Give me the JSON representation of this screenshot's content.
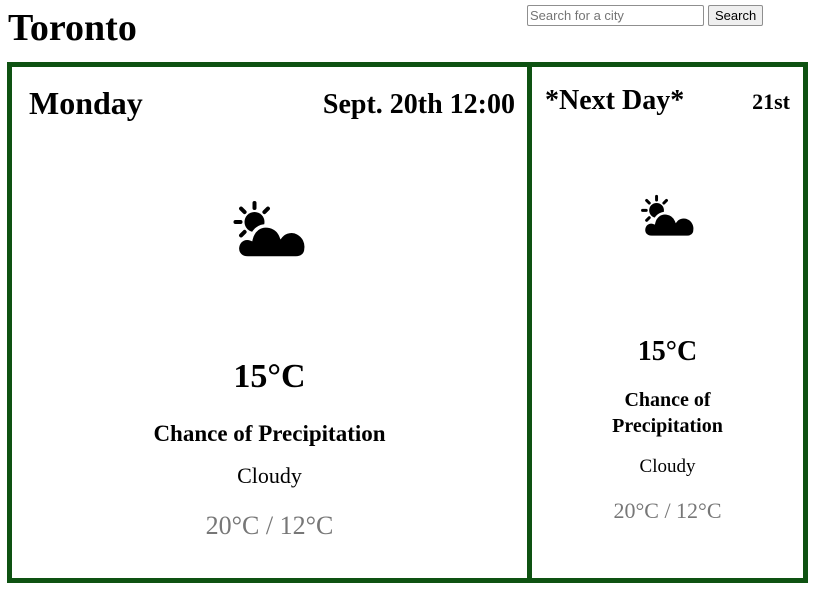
{
  "city": "Toronto",
  "search": {
    "placeholder": "Search for a city",
    "value": "",
    "button_label": "Search"
  },
  "theme": {
    "border_color": "#0e5212",
    "range_color": "#777777"
  },
  "forecast": [
    {
      "day": "Monday",
      "date": "Sept. 20th 12:00",
      "icon": "partly-cloudy-icon",
      "temperature": "15°C",
      "precipitation": "Chance of Precipitation",
      "condition": "Cloudy",
      "range": "20°C / 12°C"
    },
    {
      "day": "*Next Day*",
      "date": "21st",
      "icon": "partly-cloudy-icon",
      "temperature": "15°C",
      "precipitation": "Chance of Precipitation",
      "condition": "Cloudy",
      "range": "20°C / 12°C"
    }
  ]
}
